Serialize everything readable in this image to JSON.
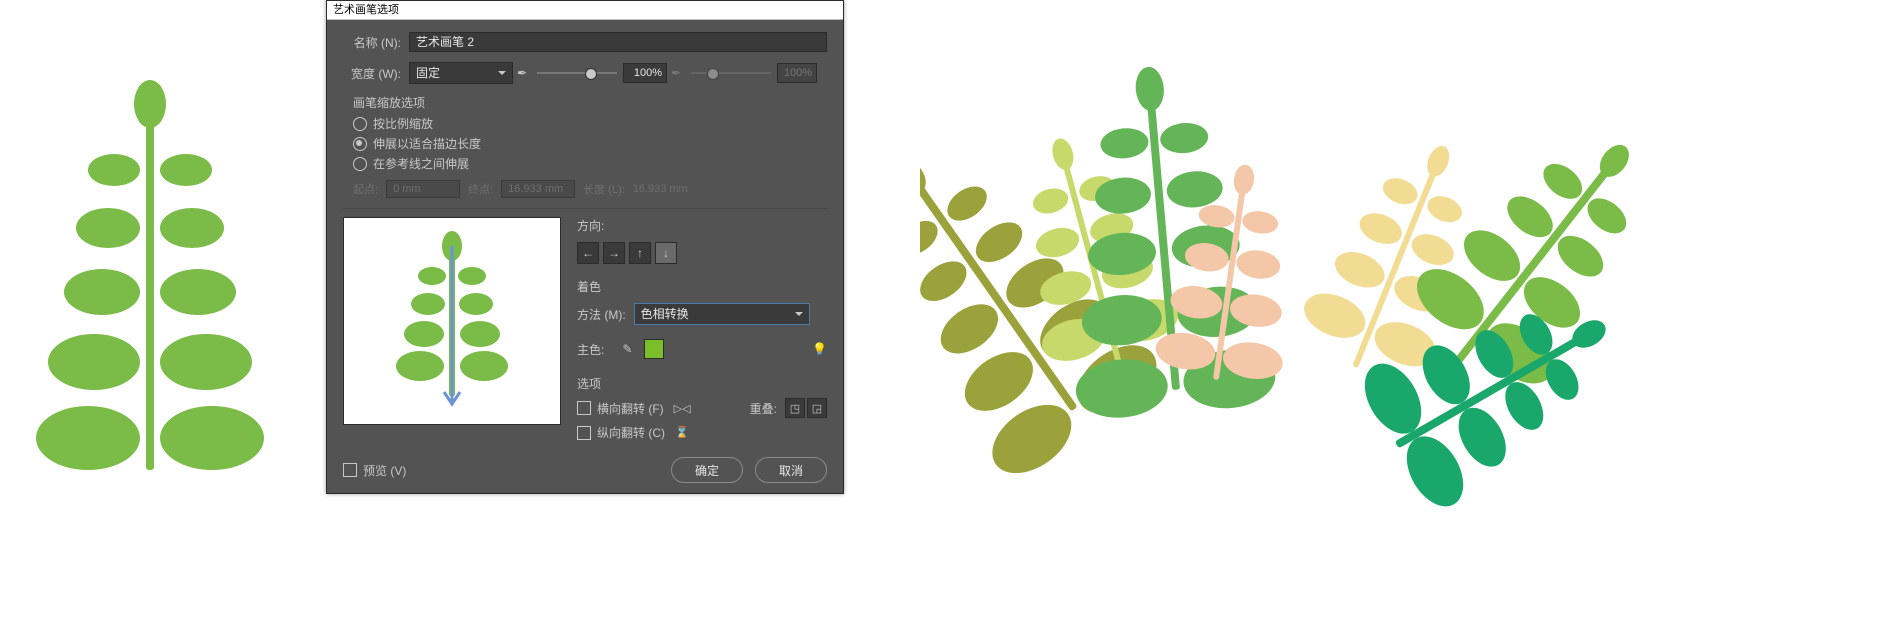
{
  "dialog": {
    "title": "艺术画笔选项",
    "name_label": "名称 (N):",
    "name_value": "艺术画笔 2",
    "width_label": "宽度 (W):",
    "width_mode": "固定",
    "width_pct": "100%",
    "width_pct2": "100%",
    "scale": {
      "title": "画笔缩放选项",
      "opt_proportional": "按比例缩放",
      "opt_stretch": "伸展以适合描边长度",
      "opt_between_guides": "在参考线之间伸展"
    },
    "disabled": {
      "start_lbl": "起点:",
      "start_val": "0 mm",
      "end_lbl": "终点:",
      "end_val": "16.933 mm",
      "len_lbl": "长度 (L):",
      "len_val": "16.933 mm"
    },
    "direction": {
      "title": "方向:"
    },
    "colorization": {
      "title": "着色",
      "method_label": "方法 (M):",
      "method_value": "色相转换",
      "key_label": "主色:",
      "key_swatch": "#7abf2a"
    },
    "options": {
      "title": "选项",
      "flip_h": "横向翻转 (F)",
      "flip_v": "纵向翻转 (C)",
      "overlap_label": "重叠:"
    },
    "footer": {
      "preview": "预览 (V)",
      "ok": "确定",
      "cancel": "取消"
    }
  },
  "icons": {
    "arrow_left": "←",
    "arrow_right": "→",
    "arrow_up": "↑",
    "arrow_down": "↓",
    "pen": "✒",
    "eyedropper": "✎",
    "tip": "💡",
    "hourglass": "⌛",
    "flip_h": "▷◁",
    "overlap_a": "◳",
    "overlap_b": "◲"
  },
  "colors": {
    "plant_green": "#7bbb47",
    "olive": "#9ba23b",
    "lime": "#c6d96a",
    "pink": "#f3c7a8",
    "cream": "#f2dc94",
    "teal": "#1aa76b",
    "mid_green": "#64b558",
    "arrow_blue": "#6b94d6"
  }
}
